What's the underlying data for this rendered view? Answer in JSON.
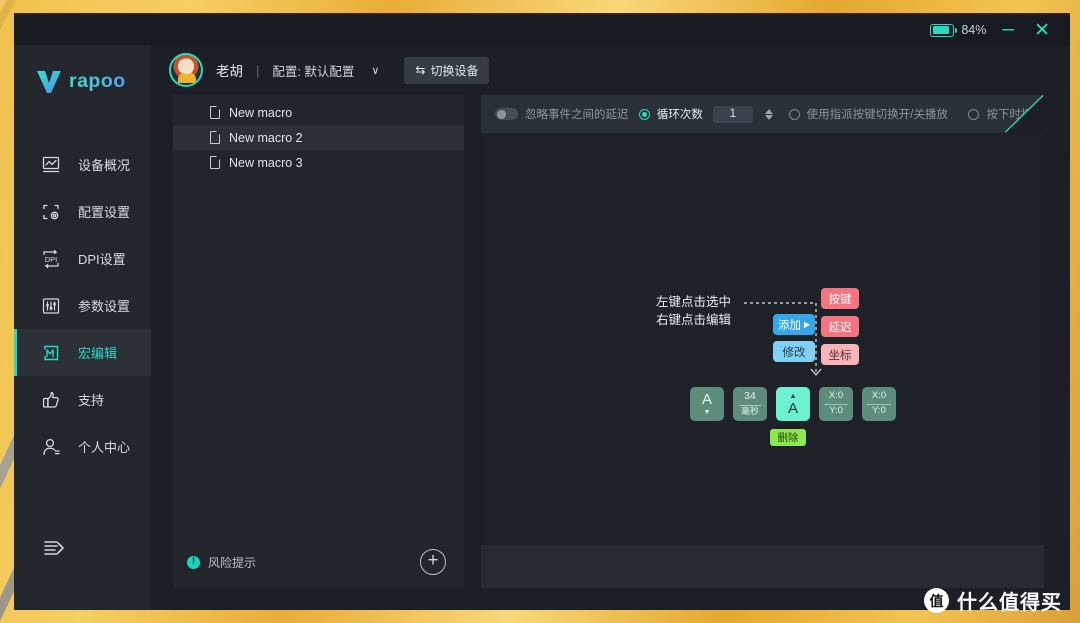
{
  "titlebar": {
    "battery_pct": "84%",
    "battery_level": 84,
    "minimize": "–",
    "close": "✕"
  },
  "sidebar": {
    "logo_text": "rapoo",
    "items": [
      {
        "label": "设备概况",
        "icon": "chart-icon",
        "active": false
      },
      {
        "label": "配置设置",
        "icon": "config-icon",
        "active": false
      },
      {
        "label": "DPI设置",
        "icon": "dpi-icon",
        "active": false
      },
      {
        "label": "参数设置",
        "icon": "sliders-icon",
        "active": false
      },
      {
        "label": "宏编辑",
        "icon": "macro-icon",
        "active": true
      },
      {
        "label": "支持",
        "icon": "thumbs-up-icon",
        "active": false
      },
      {
        "label": "个人中心",
        "icon": "user-icon",
        "active": false
      }
    ]
  },
  "userbar": {
    "name": "老胡",
    "separator": "|",
    "profile": "配置: 默认配置",
    "caret": "∨",
    "switch_device": "切换设备",
    "switch_icon": "⇆"
  },
  "macro_panel": {
    "items": [
      {
        "label": "New macro",
        "selected": false
      },
      {
        "label": "New macro 2",
        "selected": true
      },
      {
        "label": "New macro 3",
        "selected": false
      }
    ],
    "risk_label": "风险提示",
    "risk_icon": "!",
    "add_label": "+"
  },
  "options": {
    "ignore_delay": "忽略事件之间的延迟",
    "ignore_delay_on": false,
    "loop_count_label": "循环次数",
    "loop_count_selected": true,
    "loop_count_value": "1",
    "toggle_play": "使用指派按键切换开/关播放",
    "toggle_play_selected": false,
    "press_play": "按下时播放",
    "press_play_selected": false
  },
  "editor": {
    "hint_line1": "左键点击选中",
    "hint_line2": "右键点击编辑",
    "actions": {
      "add": "添加",
      "add_arrow": "▶",
      "modify": "修改",
      "key": "按键",
      "delay": "延迟",
      "coordinate": "坐标"
    },
    "delete_label": "删除",
    "events": [
      {
        "type": "key-down",
        "key": "A",
        "arrow": "▼",
        "selected": false
      },
      {
        "type": "delay",
        "value": "34",
        "unit": "毫秒",
        "selected": false
      },
      {
        "type": "key-up",
        "key": "A",
        "arrow": "▲",
        "selected": true
      },
      {
        "type": "coordinate",
        "x": "X:0",
        "y": "Y:0",
        "selected": false
      },
      {
        "type": "coordinate",
        "x": "X:0",
        "y": "Y:0",
        "selected": false
      }
    ]
  },
  "watermark": {
    "badge": "值",
    "text": "什么值得买"
  }
}
